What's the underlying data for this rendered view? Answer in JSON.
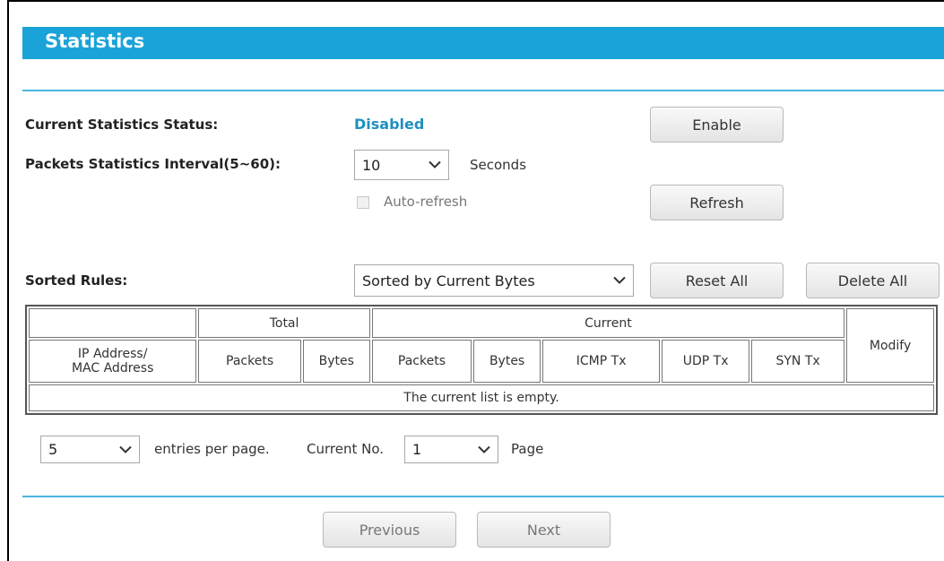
{
  "page": {
    "title": "Statistics"
  },
  "status": {
    "label": "Current Statistics Status:",
    "value": "Disabled",
    "enable_button": "Enable"
  },
  "interval": {
    "label": "Packets Statistics Interval(5~60):",
    "value": "10",
    "unit": "Seconds"
  },
  "auto_refresh": {
    "label": "Auto-refresh",
    "checked": false,
    "refresh_button": "Refresh"
  },
  "sorted": {
    "label": "Sorted Rules:",
    "value": "Sorted by Current Bytes",
    "reset_all": "Reset All",
    "delete_all": "Delete All"
  },
  "table": {
    "group_total": "Total",
    "group_current": "Current",
    "modify": "Modify",
    "ip_mac_line1": "IP Address/",
    "ip_mac_line2": "MAC Address",
    "columns": [
      "Packets",
      "Bytes",
      "Packets",
      "Bytes",
      "ICMP Tx",
      "UDP Tx",
      "SYN Tx"
    ],
    "empty": "The current list is empty."
  },
  "pagination": {
    "entries_value": "5",
    "entries_label": "entries per page.",
    "current_label": "Current No.",
    "current_value": "1",
    "page_label": "Page",
    "previous": "Previous",
    "next": "Next"
  },
  "icons": {
    "dropdown": "chevron-down-icon",
    "checkbox": "checkbox-icon"
  },
  "colors": {
    "accent": "#1aa3d9",
    "status": "#1f8fc0"
  }
}
